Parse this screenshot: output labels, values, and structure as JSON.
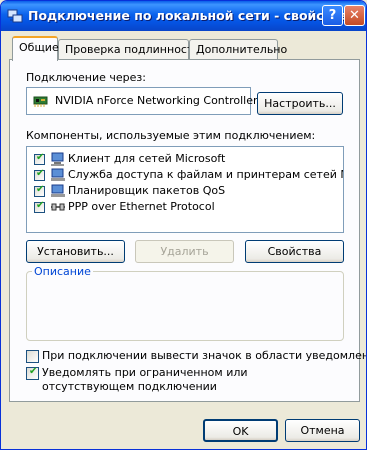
{
  "window": {
    "title": "Подключение по локальной сети - свойства",
    "help_glyph": "?",
    "close_glyph": "✕"
  },
  "tabs": [
    {
      "label": "Общие",
      "active": true
    },
    {
      "label": "Проверка подлинности",
      "active": false
    },
    {
      "label": "Дополнительно",
      "active": false
    }
  ],
  "connection": {
    "via_label": "Подключение через:",
    "device": "NVIDIA nForce Networking Controller",
    "device_icon": "network-card-icon",
    "configure_button": "Настроить..."
  },
  "components": {
    "label": "Компоненты, используемые этим подключением:",
    "items": [
      {
        "label": "Клиент для сетей Microsoft",
        "checked": true,
        "icon": "network-client-icon"
      },
      {
        "label": "Служба доступа к файлам и принтерам сетей Micro...",
        "checked": true,
        "icon": "network-service-icon"
      },
      {
        "label": "Планировщик пакетов QoS",
        "checked": true,
        "icon": "network-service-icon"
      },
      {
        "label": "PPP over Ethernet Protocol",
        "checked": true,
        "icon": "protocol-icon"
      }
    ],
    "install_button": "Установить...",
    "remove_button": "Удалить",
    "properties_button": "Свойства"
  },
  "description": {
    "legend": "Описание",
    "text": ""
  },
  "options": {
    "show_icon": {
      "label": "При подключении вывести значок в области уведомлений",
      "checked": false
    },
    "notify": {
      "label": "Уведомлять при ограниченном или отсутствующем подключении",
      "checked": true
    }
  },
  "footer": {
    "ok_button": "OK",
    "cancel_button": "Отмена"
  },
  "colors": {
    "titlebar": "#0a5ee9",
    "tab_highlight": "#f4a526",
    "legend_text": "#0046d5"
  }
}
